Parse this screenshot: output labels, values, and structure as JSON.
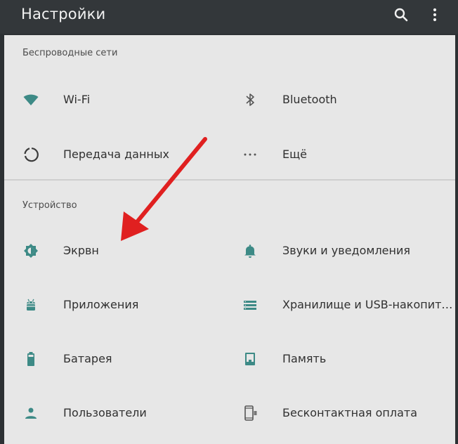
{
  "appbar": {
    "title": "Настройки",
    "actions": [
      "search-icon",
      "more-vert-icon"
    ]
  },
  "sections": {
    "wireless": {
      "header": "Беспроводные сети",
      "items": [
        {
          "label": "Wi-Fi",
          "icon": "wifi-icon"
        },
        {
          "label": "Bluetooth",
          "icon": "bluetooth-icon"
        },
        {
          "label": "Передача данных",
          "icon": "data-usage-icon"
        },
        {
          "label": "Ещё",
          "icon": "more-horiz-icon"
        }
      ]
    },
    "device": {
      "header": "Устройство",
      "items": [
        {
          "label": "Экрвн",
          "icon": "brightness-icon"
        },
        {
          "label": "Звуки и уведомления",
          "icon": "bell-icon"
        },
        {
          "label": "Приложения",
          "icon": "android-icon"
        },
        {
          "label": "Хранилище и USB-накопит…",
          "icon": "storage-icon"
        },
        {
          "label": "Батарея",
          "icon": "battery-icon"
        },
        {
          "label": "Память",
          "icon": "memory-icon"
        },
        {
          "label": "Пользователи",
          "icon": "person-icon"
        },
        {
          "label": "Бесконтактная оплата",
          "icon": "nfc-payment-icon"
        }
      ]
    }
  },
  "colors": {
    "accent": "#3d8a86",
    "appbar": "#33373a",
    "annotation_arrow": "#e02020"
  }
}
